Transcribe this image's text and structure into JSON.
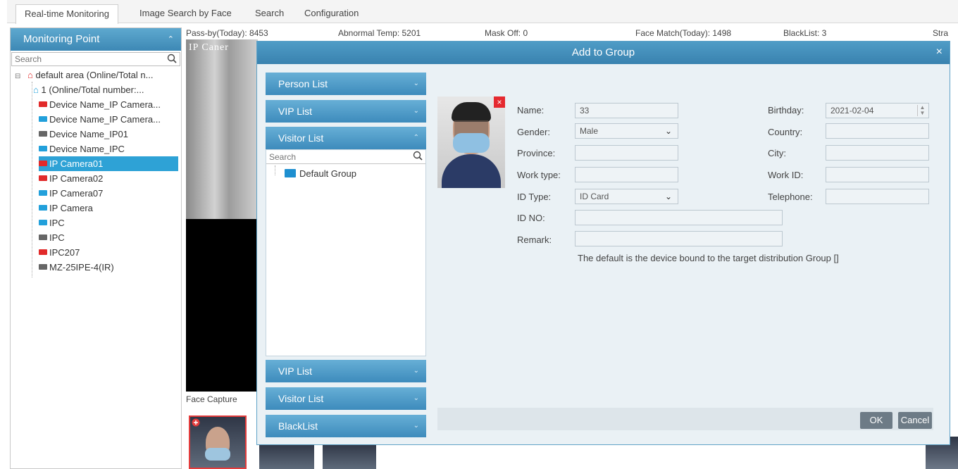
{
  "tabs": [
    {
      "label": "Real-time Monitoring"
    },
    {
      "label": "Image Search by Face"
    },
    {
      "label": "Search"
    },
    {
      "label": "Configuration"
    }
  ],
  "sidebar": {
    "title": "Monitoring Point",
    "search_placeholder": "Search",
    "tree": [
      {
        "label": "default area (Online/Total n...",
        "icon": "home-icon"
      },
      {
        "label": "1 (Online/Total number:...",
        "icon": "home-icon"
      },
      {
        "label": "Device Name_IP Camera...",
        "icon": "camera-red-icon"
      },
      {
        "label": "Device Name_IP Camera...",
        "icon": "camera-blue-icon"
      },
      {
        "label": "Device Name_IP01",
        "icon": "camera-gray-icon"
      },
      {
        "label": "Device Name_IPC",
        "icon": "camera-blue-icon"
      },
      {
        "label": "IP Camera01",
        "icon": "camera-red-icon",
        "selected": true
      },
      {
        "label": "IP Camera02",
        "icon": "camera-red-icon"
      },
      {
        "label": "IP Camera07",
        "icon": "camera-blue-icon"
      },
      {
        "label": "IP Camera",
        "icon": "camera-blue-icon"
      },
      {
        "label": "IPC",
        "icon": "camera-blue-icon"
      },
      {
        "label": "IPC",
        "icon": "camera-gray-icon"
      },
      {
        "label": "IPC207",
        "icon": "camera-red-icon"
      },
      {
        "label": "MZ-25IPE-4(IR)",
        "icon": "camera-gray-icon"
      }
    ]
  },
  "stats": {
    "pass_by": "Pass-by(Today): 8453",
    "abnormal_temp": "Abnormal Temp: 5201",
    "mask_off": "Mask Off: 0",
    "face_match": "Face Match(Today): 1498",
    "blacklist": "BlackList: 3",
    "stranger": "Stra"
  },
  "video": {
    "overlay_text": "IP Caner"
  },
  "face_capture_label": "Face Capture",
  "dialog": {
    "title": "Add to Group",
    "close_icon": "×",
    "groups_top": [
      {
        "label": "Person List",
        "expanded": false
      },
      {
        "label": "VIP List",
        "expanded": false
      },
      {
        "label": "Visitor List",
        "expanded": true
      }
    ],
    "panel_search_placeholder": "Search",
    "panel_items": [
      "Default Group"
    ],
    "groups_bottom": [
      {
        "label": "VIP List",
        "expanded": false
      },
      {
        "label": "Visitor List",
        "expanded": false
      },
      {
        "label": "BlackList",
        "expanded": false
      }
    ],
    "form": {
      "name_label": "Name:",
      "name_value": "33",
      "birthday_label": "Birthday:",
      "birthday_value": "2021-02-04",
      "gender_label": "Gender:",
      "gender_value": "Male",
      "country_label": "Country:",
      "country_value": "",
      "province_label": "Province:",
      "province_value": "",
      "city_label": "City:",
      "city_value": "",
      "work_type_label": "Work type:",
      "work_type_value": "",
      "work_id_label": "Work ID:",
      "work_id_value": "",
      "id_type_label": "ID Type:",
      "id_type_value": "ID Card",
      "telephone_label": "Telephone:",
      "telephone_value": "",
      "id_no_label": "ID NO:",
      "id_no_value": "",
      "remark_label": "Remark:",
      "remark_value": ""
    },
    "note": "The default is the device bound to the target distribution Group []",
    "ok_label": "OK",
    "cancel_label": "Cancel"
  },
  "colors": {
    "accent_blue": "#3d8bbc",
    "selected_row": "#2ea2d6",
    "camera_red": "#e12a2a",
    "camera_blue": "#22a0db",
    "camera_gray": "#666666",
    "delete_red": "#e5292f"
  }
}
